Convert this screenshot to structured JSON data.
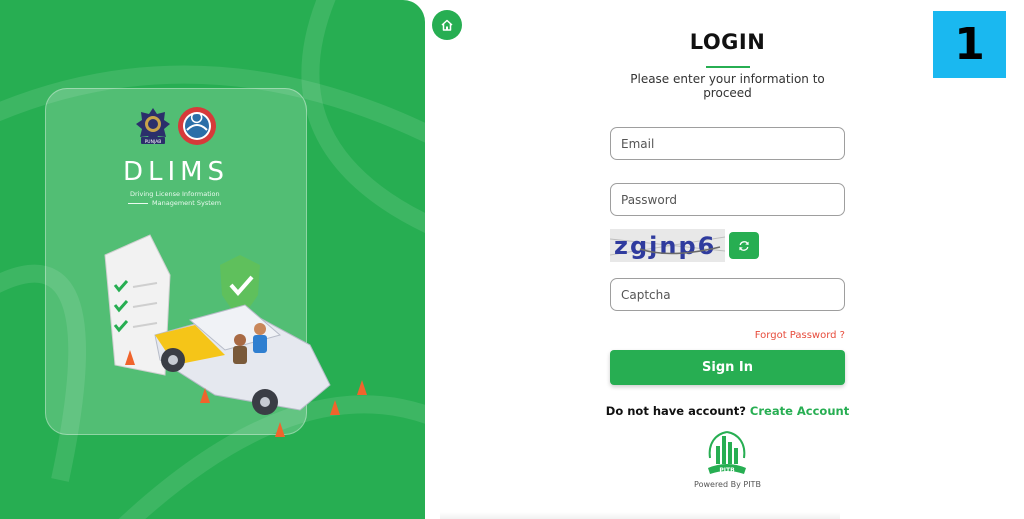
{
  "brand": {
    "title": "DLIMS",
    "subtitle_line1": "Driving License Information",
    "subtitle_line2": "Management System",
    "police_badge_text": "PUNJAB"
  },
  "login": {
    "title": "LOGIN",
    "subtitle": "Please enter your information to proceed",
    "email_placeholder": "Email",
    "password_placeholder": "Password",
    "captcha_placeholder": "Captcha",
    "captcha_text": "zgjnp6",
    "forgot_label": "Forgot Password ?",
    "signin_label": "Sign In",
    "no_account_text": "Do not have account?",
    "create_account_label": "Create Account"
  },
  "footer": {
    "logo_text": "PITB",
    "powered_by": "Powered By PITB"
  },
  "step_badge": "1",
  "colors": {
    "brand_green": "#27ae52",
    "link_red": "#e74c3c",
    "badge_blue": "#1ab8f0"
  },
  "icons": [
    "home-icon",
    "refresh-icon",
    "shield-check-icon",
    "police-badge-icon",
    "government-seal-icon",
    "pitb-logo-icon"
  ]
}
